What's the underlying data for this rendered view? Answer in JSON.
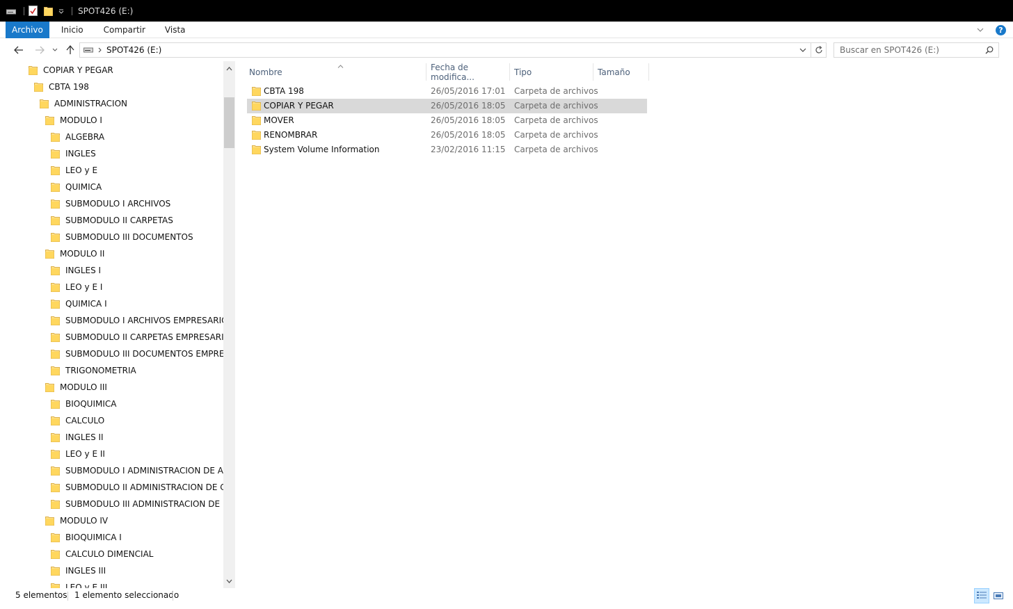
{
  "window": {
    "title": "SPOT426 (E:)"
  },
  "ribbon": {
    "tabs": [
      "Archivo",
      "Inicio",
      "Compartir",
      "Vista"
    ],
    "help_label": "?"
  },
  "address": {
    "path": "SPOT426 (E:)"
  },
  "search": {
    "placeholder": "Buscar en SPOT426 (E:)"
  },
  "nav_tree": [
    {
      "label": "COPIAR Y PEGAR",
      "level": 0
    },
    {
      "label": "CBTA 198",
      "level": 1
    },
    {
      "label": "ADMINISTRACION",
      "level": 2
    },
    {
      "label": "MODULO I",
      "level": 3
    },
    {
      "label": "ALGEBRA",
      "level": 4
    },
    {
      "label": "INGLES",
      "level": 4
    },
    {
      "label": "LEO y E",
      "level": 4
    },
    {
      "label": "QUIMICA",
      "level": 4
    },
    {
      "label": "SUBMODULO I ARCHIVOS",
      "level": 4
    },
    {
      "label": "SUBMODULO II CARPETAS",
      "level": 4
    },
    {
      "label": "SUBMODULO III DOCUMENTOS",
      "level": 4
    },
    {
      "label": "MODULO II",
      "level": 3
    },
    {
      "label": "INGLES I",
      "level": 4
    },
    {
      "label": "LEO y E I",
      "level": 4
    },
    {
      "label": "QUIMICA I",
      "level": 4
    },
    {
      "label": "SUBMODULO I ARCHIVOS EMPRESARIOS",
      "level": 4
    },
    {
      "label": "SUBMODULO II CARPETAS EMPRESARIAS",
      "level": 4
    },
    {
      "label": "SUBMODULO III DOCUMENTOS EMPRESARIOS",
      "level": 4
    },
    {
      "label": "TRIGONOMETRIA",
      "level": 4
    },
    {
      "label": "MODULO III",
      "level": 3
    },
    {
      "label": "BIOQUIMICA",
      "level": 4
    },
    {
      "label": "CALCULO",
      "level": 4
    },
    {
      "label": "INGLES II",
      "level": 4
    },
    {
      "label": "LEO y E II",
      "level": 4
    },
    {
      "label": "SUBMODULO I ADMINISTRACION DE ARCHIVOS",
      "level": 4
    },
    {
      "label": "SUBMODULO II ADMINISTRACION DE CARPETAS",
      "level": 4
    },
    {
      "label": "SUBMODULO III ADMINISTRACION DE DOCUMENTOS",
      "level": 4
    },
    {
      "label": "MODULO IV",
      "level": 3
    },
    {
      "label": "BIOQUIMICA I",
      "level": 4
    },
    {
      "label": "CALCULO DIMENCIAL",
      "level": 4
    },
    {
      "label": "INGLES III",
      "level": 4
    },
    {
      "label": "LEO y E III",
      "level": 4
    }
  ],
  "columns": {
    "name": "Nombre",
    "date": "Fecha de modifica...",
    "type": "Tipo",
    "size": "Tamaño"
  },
  "files": [
    {
      "name": "CBTA 198",
      "date": "26/05/2016 17:01",
      "type": "Carpeta de archivos",
      "selected": false
    },
    {
      "name": "COPIAR Y PEGAR",
      "date": "26/05/2016 18:05",
      "type": "Carpeta de archivos",
      "selected": true
    },
    {
      "name": "MOVER",
      "date": "26/05/2016 18:05",
      "type": "Carpeta de archivos",
      "selected": false
    },
    {
      "name": "RENOMBRAR",
      "date": "26/05/2016 18:05",
      "type": "Carpeta de archivos",
      "selected": false
    },
    {
      "name": "System Volume Information",
      "date": "23/02/2016 11:15",
      "type": "Carpeta de archivos",
      "selected": false
    }
  ],
  "status": {
    "count": "5 elementos",
    "selection": "1 elemento seleccionado"
  },
  "colors": {
    "accent": "#1979ca",
    "folder": "#ffd75e",
    "selection": "#d9d9d9",
    "header_text": "#4c607a"
  }
}
